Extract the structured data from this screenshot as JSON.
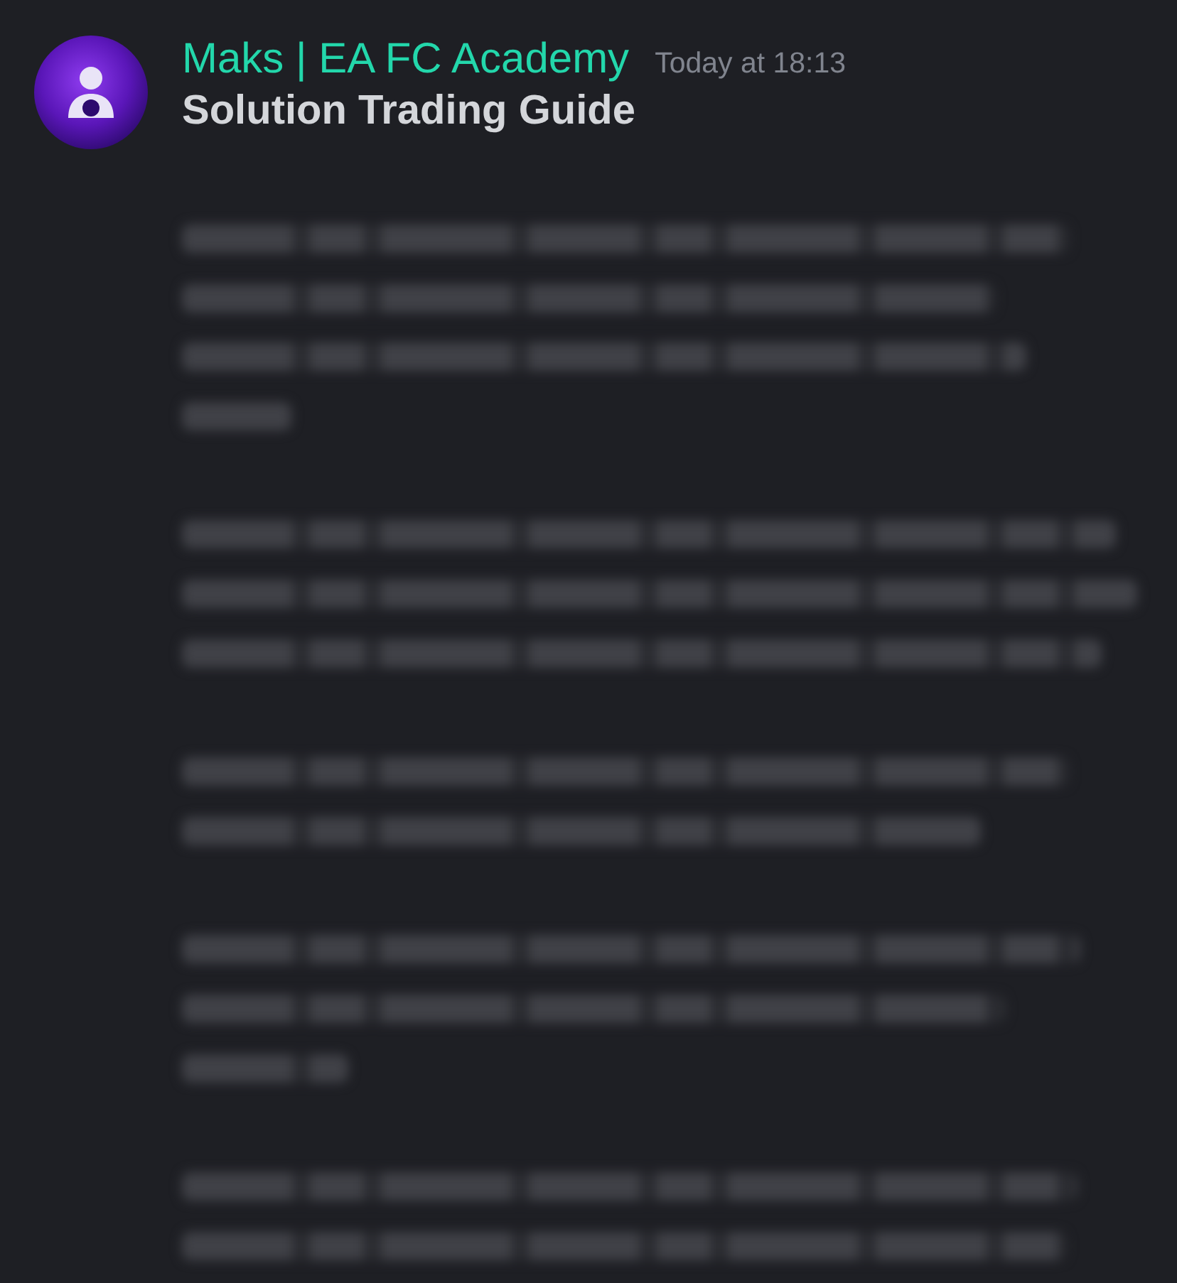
{
  "message": {
    "author": "Maks | EA FC Academy",
    "timestamp": "Today at 18:13",
    "title": "Solution Trading Guide",
    "body_blurred": true
  }
}
